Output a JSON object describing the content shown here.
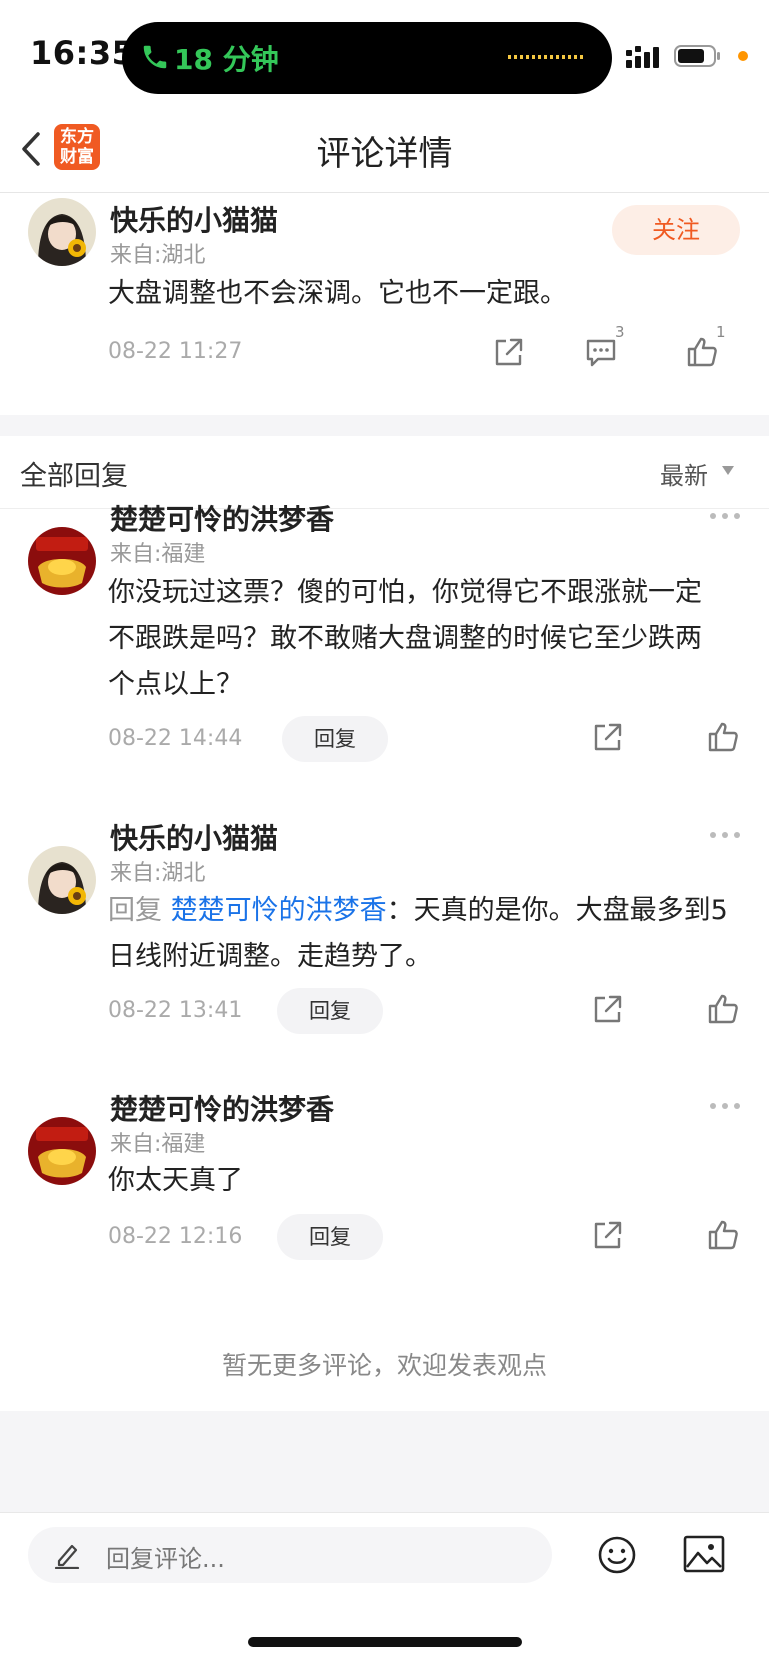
{
  "status_bar": {
    "time": "16:35",
    "call_duration": "18 分钟",
    "icons": [
      "phone-icon",
      "signal-icon",
      "battery-icon"
    ]
  },
  "nav": {
    "title": "评论详情",
    "logo_line1": "东方",
    "logo_line2": "财富",
    "brand_color": "#f05a22"
  },
  "main_comment": {
    "username": "快乐的小猫猫",
    "location": "来自:湖北",
    "follow_label": "关注",
    "content": "大盘调整也不会深调。它也不一定跟。",
    "date": "08-22 11:27",
    "comment_count": "3",
    "like_count": "1"
  },
  "replies_header": {
    "title": "全部回复",
    "sort_label": "最新"
  },
  "replies": [
    {
      "username": "楚楚可怜的洪梦香",
      "location": "来自:福建",
      "content": "你没玩过这票？傻的可怕，你觉得它不跟涨就一定不跟跌是吗？敢不敢赌大盘调整的时候它至少跌两个点以上？",
      "date": "08-22 14:44",
      "reply_label": "回复"
    },
    {
      "username": "快乐的小猫猫",
      "location": "来自:湖北",
      "reply_prefix": "回复 ",
      "reply_target": "楚楚可怜的洪梦香",
      "content": "：天真的是你。大盘最多到5日线附近调整。走趋势了。",
      "date": "08-22 13:41",
      "reply_label": "回复"
    },
    {
      "username": "楚楚可怜的洪梦香",
      "location": "来自:福建",
      "content": "你太天真了",
      "date": "08-22 12:16",
      "reply_label": "回复"
    }
  ],
  "end_text": "暂无更多评论，欢迎发表观点",
  "bottom_bar": {
    "placeholder": "回复评论..."
  }
}
